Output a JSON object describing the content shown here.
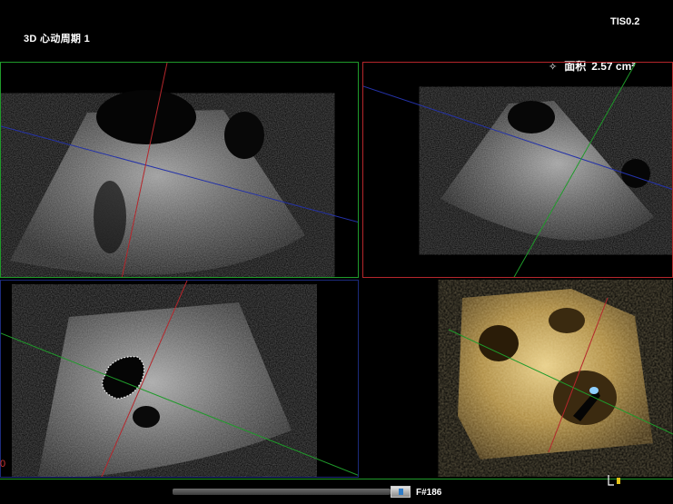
{
  "header": {
    "title": "3D 心动周期 1",
    "tis": "TIS0.2"
  },
  "measurement": {
    "icon": "crosshair-icon",
    "label": "面积",
    "value": "2.57 cm²"
  },
  "footer": {
    "frame_number": "F#186",
    "side_marker": "0"
  },
  "colors": {
    "frame_green": "#1f9a2a",
    "frame_red": "#b5262b",
    "frame_blue": "#1c2a7a",
    "volume_gold": "#c9a557"
  }
}
